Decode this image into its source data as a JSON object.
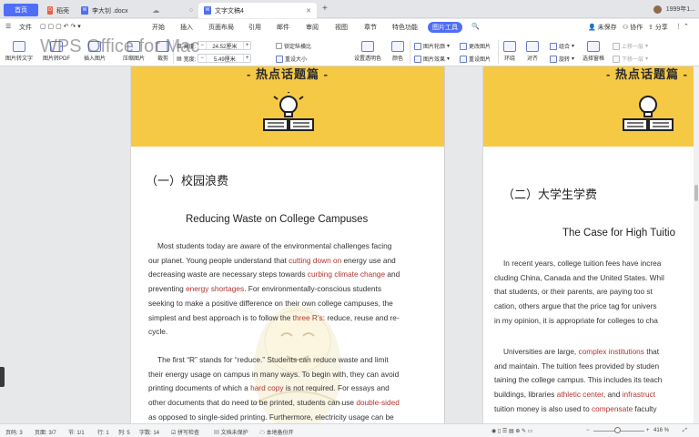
{
  "tabs": {
    "home": "首页",
    "doc": "稻壳",
    "tab3": "李大钊 .docx",
    "tab4": "文字文稿4",
    "doc_icon_text": "W"
  },
  "topright": {
    "user": "1999年1..."
  },
  "menu": [
    "文件",
    "开始",
    "插入",
    "页面布局",
    "引用",
    "邮件",
    "审阅",
    "视图",
    "章节",
    "特色功能",
    "图片工具"
  ],
  "menu_active": "图片工具",
  "menu_right": [
    "未保存",
    "协作",
    "分享"
  ],
  "ribbon": {
    "pic_to_text": "图片转文字",
    "pic_to_pdf": "图片转PDF",
    "insert_pic": "插入图片",
    "compress": "压缩图片",
    "crop": "裁剪",
    "height_label": "高度:",
    "height_value": "24.52厘米",
    "width_label": "宽度:",
    "width_value": "5.49厘米",
    "lock_ratio": "锁定纵横比",
    "reset_size": "重设大小",
    "transparent": "设置透明色",
    "color": "颜色",
    "outline": "图片轮廓",
    "effect": "图片效果",
    "change_pic": "更改图片",
    "reset_pic": "重设图片",
    "wrap": "环绕",
    "align": "对齐",
    "group": "组合",
    "rotate": "旋转",
    "select_pane": "选择窗格",
    "up_layer": "上移一层",
    "down_layer": "下移一层"
  },
  "watermark": "WPS Office for Mac",
  "page1": {
    "banner_title": "- 热点话题篇 -",
    "heading_cn": "（一）校园浪费",
    "heading_en": "Reducing Waste on College Campuses",
    "p1": [
      [
        "Most students today are aware of the environmental challenges facing"
      ],
      [
        "our planet. Young people understand that ",
        {
          "r": "cutting down on"
        },
        " energy use and"
      ],
      [
        "decreasing waste are necessary steps towards ",
        {
          "r": "curbing climate change"
        },
        " and"
      ],
      [
        "preventing ",
        {
          "r": "energy shortages"
        },
        ". For environmentally-conscious students"
      ],
      [
        "seeking to make a positive difference on their own college campuses, the"
      ],
      [
        "simplest and best approach is to follow the ",
        {
          "r": "three R’s"
        },
        ": reduce, reuse and re-"
      ],
      [
        "cycle."
      ]
    ],
    "p2": [
      [
        "The first “R” stands for “reduce.” Students can reduce waste and limit"
      ],
      [
        "their energy usage on campus in many ways. To begin with, they can avoid"
      ],
      [
        "printing documents of which a ",
        {
          "r": "hard copy"
        },
        " is not required. For essays and"
      ],
      [
        "other documents that do need to be printed, students can use ",
        {
          "r": "double-sided"
        }
      ],
      [
        "as opposed to single-sided printing. Furthermore, electricity usage can be"
      ]
    ]
  },
  "page2": {
    "banner_title": "- 热点话题篇 -",
    "heading_cn": "（二）大学生学费",
    "heading_en": "The Case for High Tuitio",
    "p1": [
      [
        "In recent years, college tuition fees have increa"
      ],
      [
        "cluding China, Canada and the United States. Whil"
      ],
      [
        "that students, or their parents, are paying too st"
      ],
      [
        "cation, others argue that the price tag for univers"
      ],
      [
        "in my opinion, it is appropriate for colleges to cha"
      ]
    ],
    "p2": [
      [
        "Universities are large, ",
        {
          "r": "complex institutions"
        },
        " that"
      ],
      [
        "and maintain. The tuition fees provided by studen"
      ],
      [
        "taining the college campus. This includes its teach"
      ],
      [
        "buildings, libraries ",
        {
          "r": "athletic center"
        },
        ", and ",
        {
          "r": "infrastruct"
        }
      ],
      [
        "tuition money is also used to ",
        {
          "r": "compensate"
        },
        " faculty"
      ]
    ]
  },
  "status": {
    "page": "页码: 3",
    "pages": "页面: 3/7",
    "section": "节: 1/1",
    "row": "行: 1",
    "col": "列: 5",
    "words": "字数: 14",
    "spell": "拼写检查",
    "doc_protect": "文档未保护",
    "backup": "本地备份开",
    "zoom": "416 %",
    "zoom_level": 0.47
  },
  "colors": {
    "accent": "#4f6ef7",
    "banner": "#f6c945",
    "highlight": "#b5332f"
  }
}
